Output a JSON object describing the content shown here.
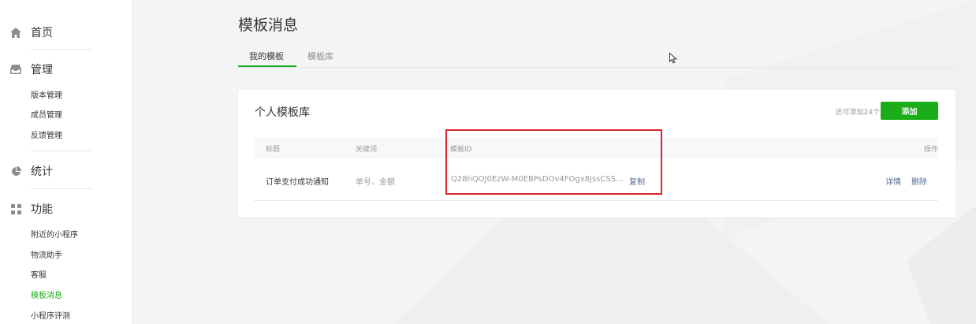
{
  "sidebar": {
    "home": {
      "label": "首页",
      "icon": "home-icon"
    },
    "manage": {
      "label": "管理",
      "icon": "inbox-icon",
      "items": [
        "版本管理",
        "成员管理",
        "反馈管理"
      ]
    },
    "stats": {
      "label": "统计",
      "icon": "pie-chart-icon"
    },
    "features": {
      "label": "功能",
      "icon": "grid-icon",
      "items": [
        "附近的小程序",
        "物流助手",
        "客服",
        "模板消息",
        "小程序评测"
      ],
      "active_item": "模板消息"
    }
  },
  "page": {
    "title": "模板消息",
    "tabs": [
      "我的模板",
      "模板库"
    ]
  },
  "card": {
    "title": "个人模板库",
    "quota": "还可添加24个",
    "add_label": "添加",
    "columns": [
      "标题",
      "关键词",
      "模板ID",
      "操作"
    ],
    "rows": [
      {
        "title": "订单支付成功通知",
        "keywords": "单号、金额",
        "template_id": "Q28hQOJ0EzW-M0EBPsDOv4FOgx8JssCSS...",
        "copy_label": "复制",
        "detail_label": "详情",
        "delete_label": "删除"
      }
    ]
  },
  "colors": {
    "accent": "#1aad19",
    "link": "#576b95",
    "highlight": "#d9262b"
  }
}
